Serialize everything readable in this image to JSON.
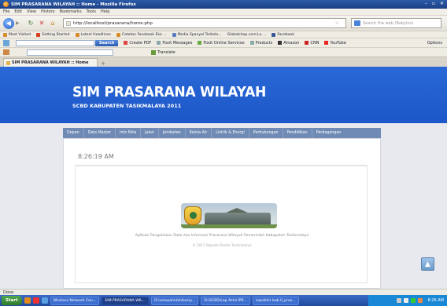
{
  "window": {
    "title": "SIM PRASARANA WILAYAH :: Home - Mozilla Firefox"
  },
  "menubar": [
    "File",
    "Edit",
    "View",
    "History",
    "Bookmarks",
    "Tools",
    "Help"
  ],
  "navigation": {
    "url": "http://localhost/prasarana/home.php",
    "search_placeholder": "Search the web (Babylon)"
  },
  "bookmarks": [
    "Most Visited",
    "Getting Started",
    "Latest Headlines",
    "Catatan Facebook Eko ...",
    "Media Spanyol Terbela...",
    "Globalshop.com:Lu ...",
    "Facebook"
  ],
  "toolbar2": {
    "search_label": "Search",
    "items": [
      "Create PDF",
      "Foxit Messages",
      "Foxit Online Services",
      "Products",
      "Amazon",
      "CNN",
      "YouTube"
    ],
    "options": "Options"
  },
  "toolbar3": {
    "translate": "Translate"
  },
  "tab": {
    "label": "SIM PRASARANA WILAYAH :: Home"
  },
  "site": {
    "title": "SIM PRASARANA WILAYAH",
    "subtitle": "SCBD KABUPATEN TASIKMALAYA 2011"
  },
  "main_nav": [
    "Depan",
    "Data Master",
    "Info Peta",
    "Jalan",
    "Jembatan",
    "Kelola Air",
    "Listrik & Energi",
    "Perhubungan",
    "Pendidikan",
    "Perdagangan"
  ],
  "content": {
    "clock": "8:26:19 AM",
    "caption": "Aplikasi Pengelolaan Data dan Informasi Prasarana Wilayah Pemerintah Kabupaten Tasikmalaya",
    "copyright": "© 2011 Bapeda Desita Tasikmalaya"
  },
  "status": {
    "text": "Done"
  },
  "taskbar": {
    "start": "Start",
    "tasks": [
      "Wireless Network Con...",
      "SIM PRASARANA WIL...",
      "D:\\sampah\\a\\Inbox\\p...",
      "D:\\SCBD\\Lap Akhir\\PR...",
      "Lapakhir bab II_pras..."
    ],
    "time": "8:26 AM"
  }
}
